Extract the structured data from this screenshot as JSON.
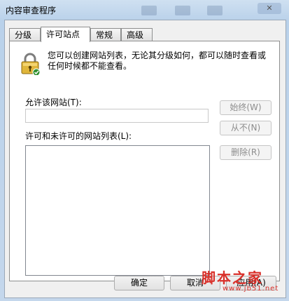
{
  "window": {
    "title": "内容审查程序"
  },
  "tabs": [
    {
      "label": "分级"
    },
    {
      "label": "许可站点"
    },
    {
      "label": "常规"
    },
    {
      "label": "高级"
    }
  ],
  "panel": {
    "description": "您可以创建网站列表，无论其分级如何，都可以随时查看或任何时候都不能查看。",
    "allow_label": "允许该网站(T):",
    "allow_input_value": "",
    "always_button": "始终(W)",
    "never_button": "从不(N)",
    "list_label": "许可和未许可的网站列表(L):",
    "remove_button": "删除(R)",
    "sites": []
  },
  "footer": {
    "ok_button": "确定",
    "cancel_button": "取消",
    "apply_button": "应用(A)"
  },
  "watermark": {
    "text": "脚本之家",
    "url": "www.jb51.net"
  }
}
